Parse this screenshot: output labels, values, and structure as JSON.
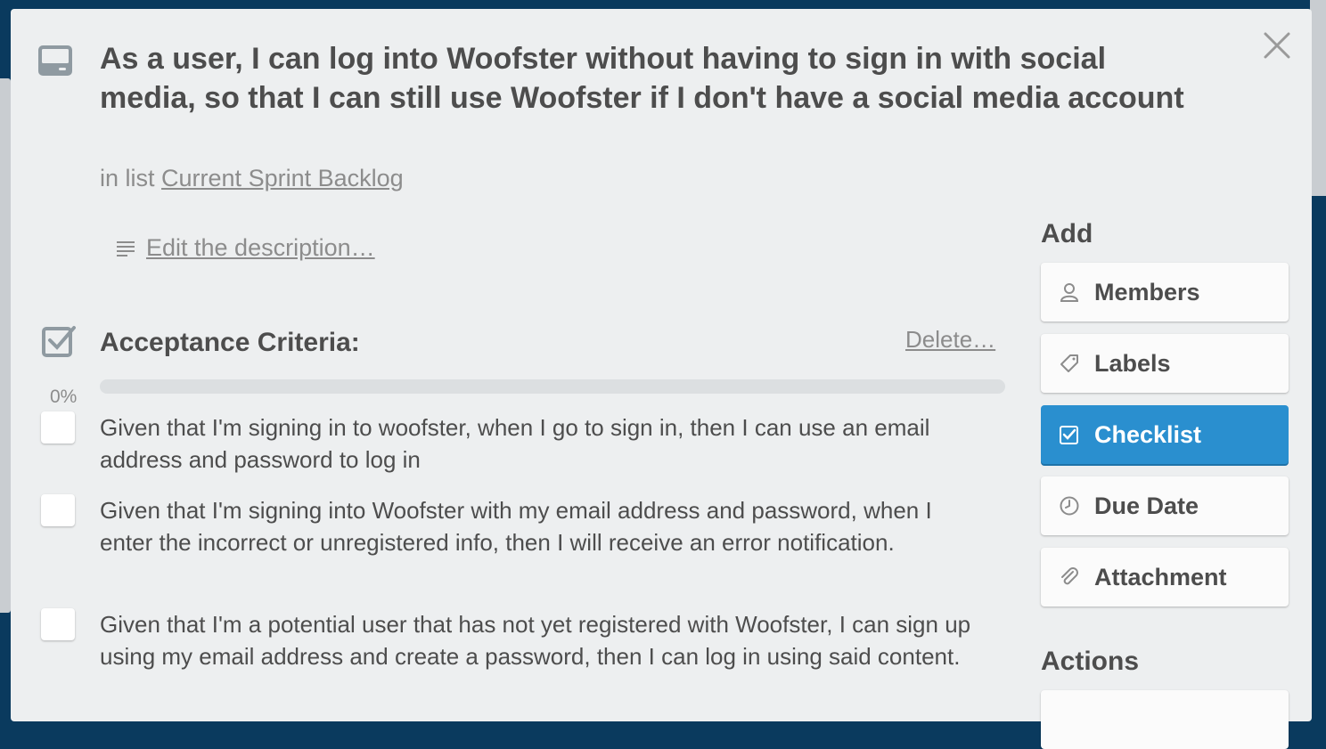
{
  "card": {
    "title": "As a user, I can log into Woofster without having to sign in with social media, so that I can still use Woofster if I don't have a social media account",
    "in_list_prefix": "in list",
    "list_name": "Current Sprint Backlog",
    "edit_description": "Edit the description…"
  },
  "checklist": {
    "title": "Acceptance Criteria:",
    "delete_label": "Delete…",
    "progress_label": "0%",
    "progress_fraction": 0,
    "items": [
      {
        "text": "Given that I'm signing in to woofster, when I go to sign in, then I can use an email address and password to log in",
        "checked": false
      },
      {
        "text": "Given that I'm signing into Woofster with my email address and password, when I enter the incorrect or unregistered info, then I will receive an error notification.",
        "checked": false
      },
      {
        "text": "Given that I'm a potential user that has not yet registered with Woofster, I can sign up using my email address and create a password, then I can log in using said content.",
        "checked": false
      }
    ]
  },
  "sidebar": {
    "add_heading": "Add",
    "buttons": [
      {
        "label": "Members",
        "icon": "person-icon"
      },
      {
        "label": "Labels",
        "icon": "tag-icon"
      },
      {
        "label": "Checklist",
        "icon": "checkbox-icon",
        "active": true
      },
      {
        "label": "Due Date",
        "icon": "clock-icon"
      },
      {
        "label": "Attachment",
        "icon": "paperclip-icon"
      }
    ],
    "actions_heading": "Actions"
  },
  "colors": {
    "accent": "#2a8fcf",
    "text": "#4d4d4d",
    "muted": "#8c8c8c",
    "backdrop": "#0a3a5e"
  }
}
